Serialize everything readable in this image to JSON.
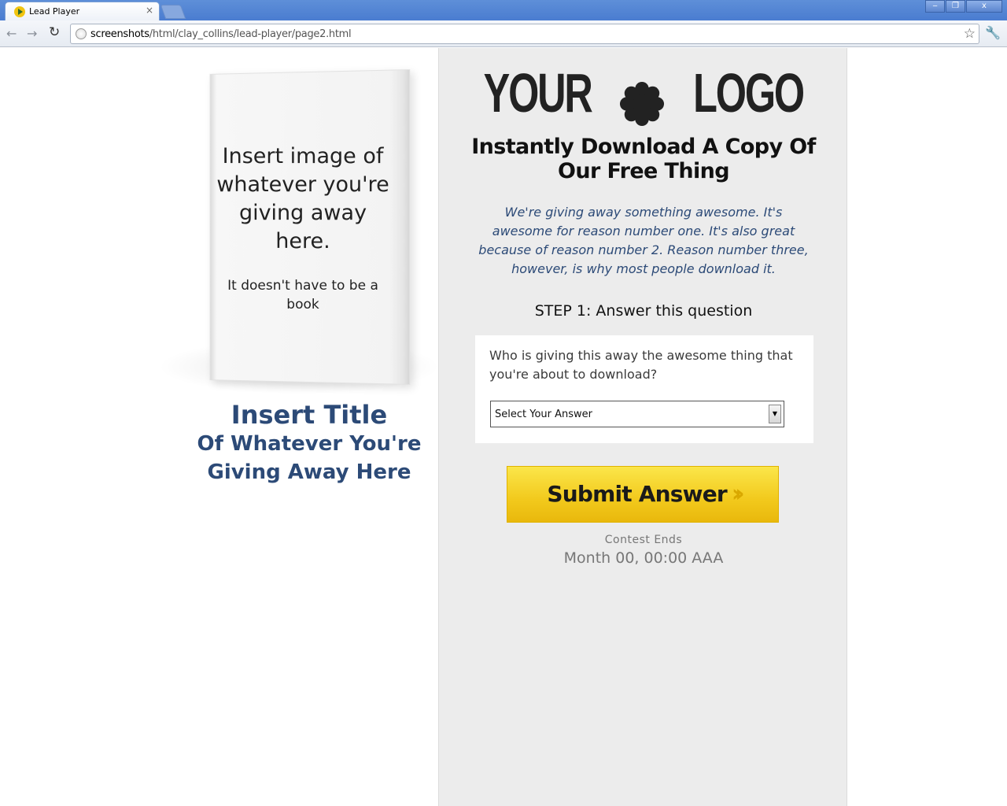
{
  "browser": {
    "tab_title": "Lead Player",
    "tab_close": "×",
    "url_host": "screenshots",
    "url_path": "/html/clay_collins/lead-player/page2.html",
    "window_buttons": [
      "‒",
      "❐",
      "x"
    ]
  },
  "book": {
    "main_text": "Insert image of whatever you're giving away here.",
    "sub_text": "It doesn't have to be a book"
  },
  "giveaway_title": {
    "line1": "Insert Title",
    "line2": "Of Whatever You're Giving Away Here"
  },
  "logo": {
    "left": "YOUR",
    "right": "LOGO"
  },
  "headline": "Instantly Download A Copy Of Our Free Thing",
  "description": "We're giving away something awesome. It's awesome for reason number one. It's also great because of reason number 2. Reason number three, however, is why most people download it.",
  "step": "STEP 1: Answer this question",
  "question": "Who is giving this away the awesome thing that you're about to download?",
  "answer_select": {
    "selected": "Select Your Answer"
  },
  "submit_label": "Submit Answer",
  "contest": {
    "label": "Contest Ends",
    "date": "Month 00, 00:00 AAA"
  },
  "colors": {
    "title_blue": "#2c4a77",
    "button_yellow": "#f2c91c",
    "panel_gray": "#ececec"
  }
}
